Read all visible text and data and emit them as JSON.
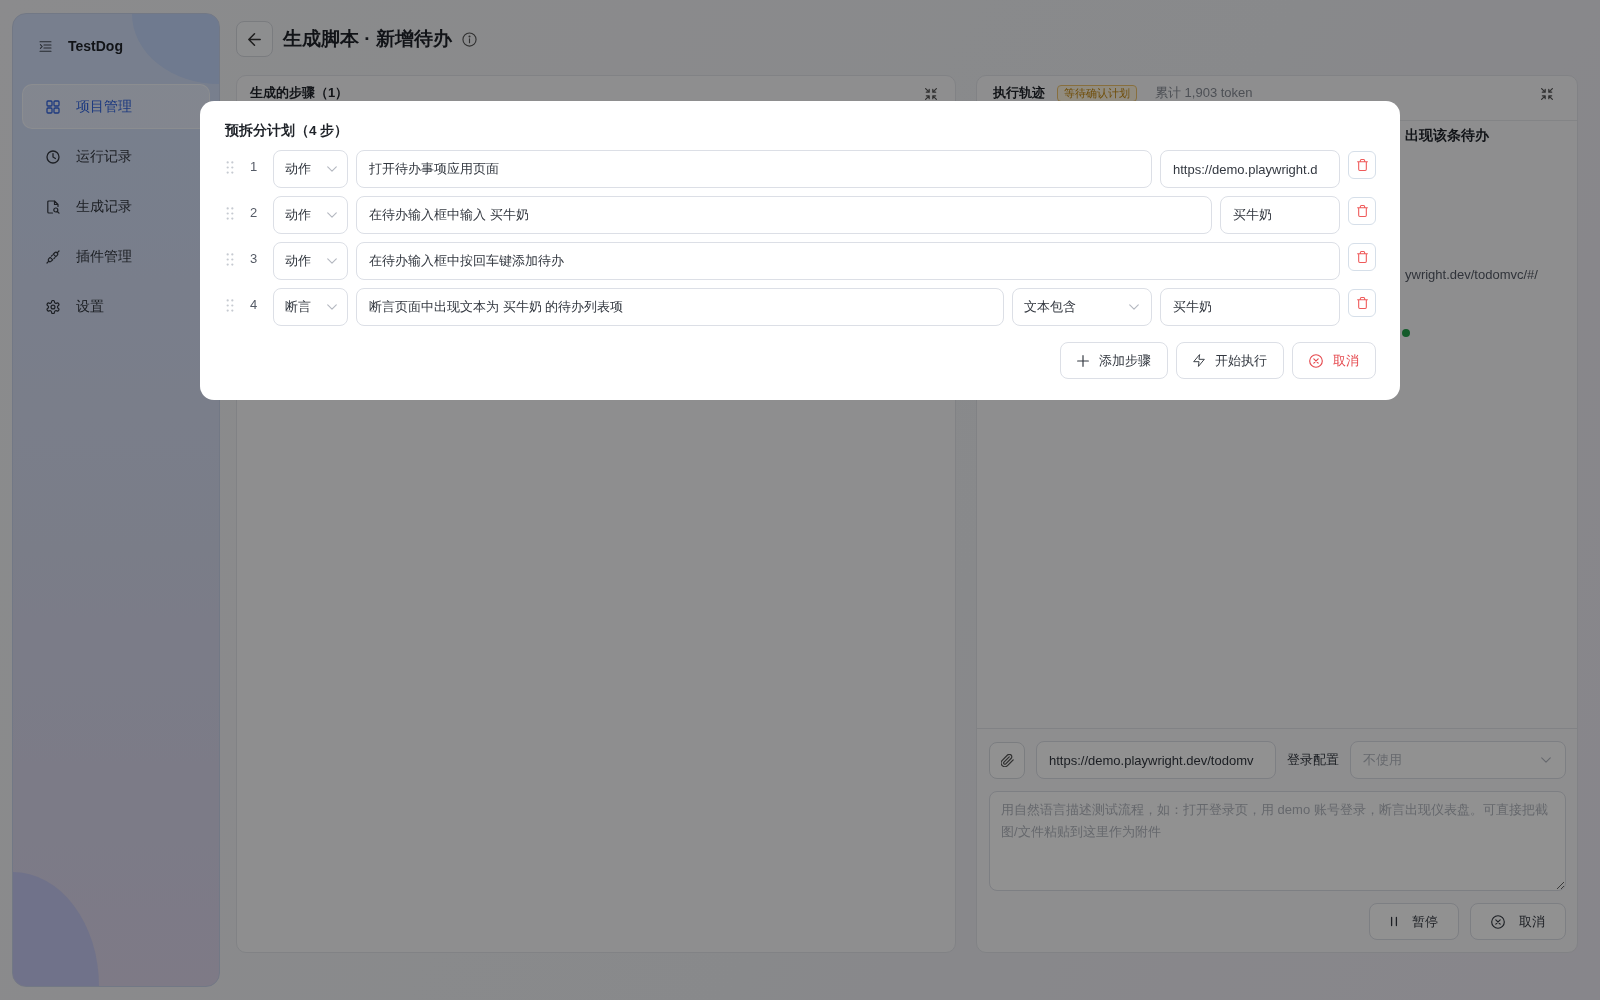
{
  "sidebar": {
    "brand": "TestDog",
    "items": [
      {
        "label": "项目管理",
        "selected": true
      },
      {
        "label": "运行记录",
        "selected": false
      },
      {
        "label": "生成记录",
        "selected": false
      },
      {
        "label": "插件管理",
        "selected": false
      },
      {
        "label": "设置",
        "selected": false
      }
    ]
  },
  "header": {
    "title": "生成脚本 · 新增待办"
  },
  "steps_panel": {
    "title": "生成的步骤（1）"
  },
  "trace_panel": {
    "title": "执行轨迹",
    "status_badge": "等待确认计划",
    "token_count": "累计 1,903 token",
    "lines": [
      {
        "kind": "heading",
        "text": "出现该条待办"
      },
      {
        "kind": "url",
        "text": "ywright.dev/todomvc/#/"
      }
    ]
  },
  "composer": {
    "url": "https://demo.playwright.dev/todomv",
    "login_label": "登录配置",
    "login_placeholder": "不使用",
    "prompt_placeholder": "用自然语言描述测试流程，如：打开登录页，用 demo 账号登录，断言出现仪表盘。可直接把截图/文件粘贴到这里作为附件",
    "buttons": [
      {
        "kind": "pause",
        "label": "暂停"
      },
      {
        "kind": "cancel",
        "label": "取消"
      }
    ]
  },
  "plan_dialog": {
    "title": "预拆分计划（4 步）",
    "steps": [
      {
        "number": "1",
        "type": "动作",
        "kind": "navigate",
        "description": "打开待办事项应用页面",
        "value": "https://demo.playwright.d"
      },
      {
        "number": "2",
        "type": "动作",
        "kind": "fill",
        "description": "在待办输入框中输入 买牛奶",
        "value": "买牛奶"
      },
      {
        "number": "3",
        "type": "动作",
        "kind": "press",
        "description": "在待办输入框中按回车键添加待办"
      },
      {
        "number": "4",
        "type": "断言",
        "kind": "assert",
        "description": "断言页面中出现文本为 买牛奶 的待办列表项",
        "matcher": "文本包含",
        "value": "买牛奶"
      }
    ],
    "buttons": [
      {
        "kind": "add",
        "label": "添加步骤"
      },
      {
        "kind": "run",
        "label": "开始执行"
      },
      {
        "kind": "cancel",
        "label": "取消"
      }
    ]
  }
}
